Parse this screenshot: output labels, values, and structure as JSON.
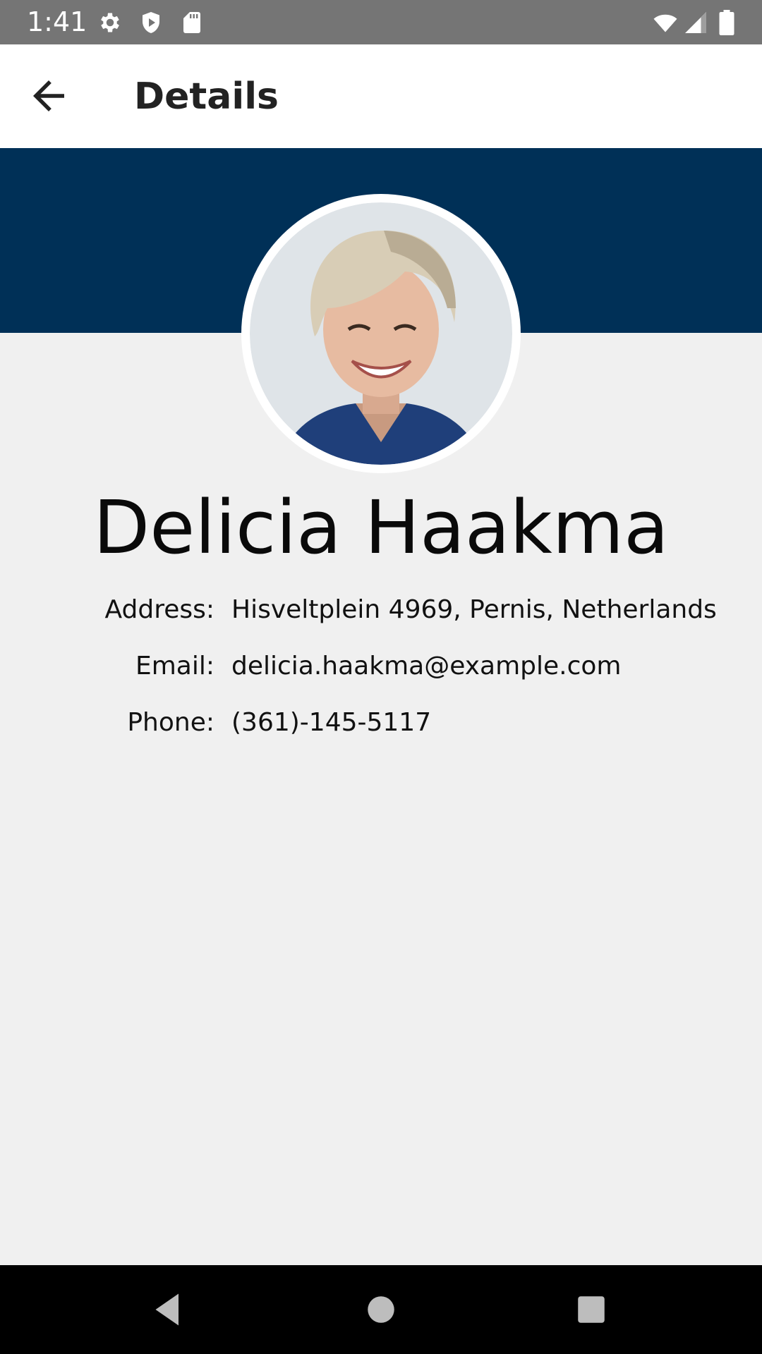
{
  "status_bar": {
    "time": "1:41",
    "icons_left": [
      "gear-icon",
      "shield-icon",
      "sd-card-icon"
    ],
    "icons_right": [
      "wifi-icon",
      "cell-signal-icon",
      "battery-icon"
    ]
  },
  "app_bar": {
    "back_icon": "arrow-back-icon",
    "title": "Details"
  },
  "profile": {
    "name": "Delicia Haakma",
    "header_color": "#003057",
    "fields": [
      {
        "label": "Address:",
        "value": "Hisveltplein 4969, Pernis, Netherlands"
      },
      {
        "label": "Email:",
        "value": "delicia.haakma@example.com"
      },
      {
        "label": "Phone:",
        "value": "(361)-145-5117"
      }
    ]
  },
  "nav_bar": {
    "buttons": [
      "back-triangle-icon",
      "home-circle-icon",
      "recents-square-icon"
    ]
  }
}
